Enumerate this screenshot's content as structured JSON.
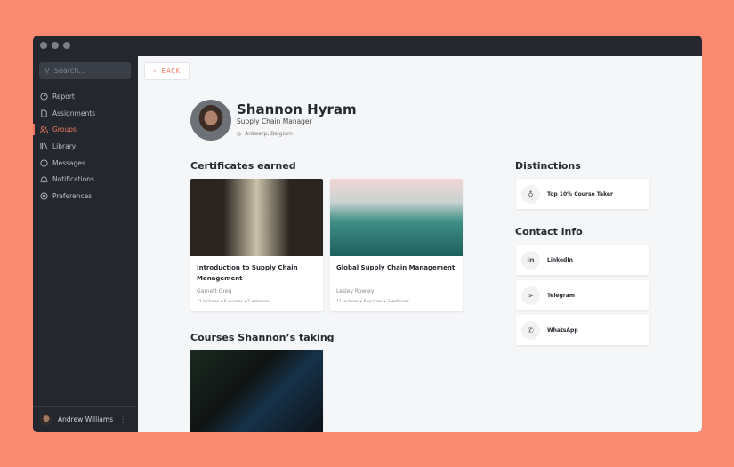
{
  "sidebar": {
    "search_placeholder": "Search...",
    "items": [
      {
        "label": "Report",
        "icon": "gauge-icon"
      },
      {
        "label": "Assignments",
        "icon": "file-icon"
      },
      {
        "label": "Groups",
        "icon": "users-icon",
        "active": true
      },
      {
        "label": "Library",
        "icon": "library-icon"
      },
      {
        "label": "Messages",
        "icon": "chat-icon"
      },
      {
        "label": "Notifications",
        "icon": "bell-icon"
      },
      {
        "label": "Preferences",
        "icon": "gear-icon"
      }
    ],
    "user": {
      "name": "Andrew Williams"
    }
  },
  "main": {
    "back_label": "BACK",
    "profile": {
      "name": "Shannon Hyram",
      "role": "Supply Chain Manager",
      "location": "Antwerp, Belgium"
    },
    "certificates_heading": "Certificates earned",
    "certificates": [
      {
        "title": "Introduction to Supply Chain Management",
        "author": "Garnett Greg",
        "meta": "12 lectures  •  6 quizzes  •  5 webinars"
      },
      {
        "title": "Global Supply Chain Management",
        "author": "Lesley Rowley",
        "meta": "11 lectures  •  6 quizzes  •  3 webinars"
      }
    ],
    "courses_heading": "Courses Shannon’s taking",
    "distinctions_heading": "Distinctions",
    "distinctions": [
      {
        "label": "Top 10% Course Taker"
      }
    ],
    "contact_heading": "Contact info",
    "contacts": [
      {
        "label": "LinkedIn"
      },
      {
        "label": "Telegram"
      },
      {
        "label": "WhatsApp"
      }
    ]
  },
  "colors": {
    "accent": "#f0775f",
    "background": "#fb8a72",
    "sidebar": "#24282e"
  }
}
